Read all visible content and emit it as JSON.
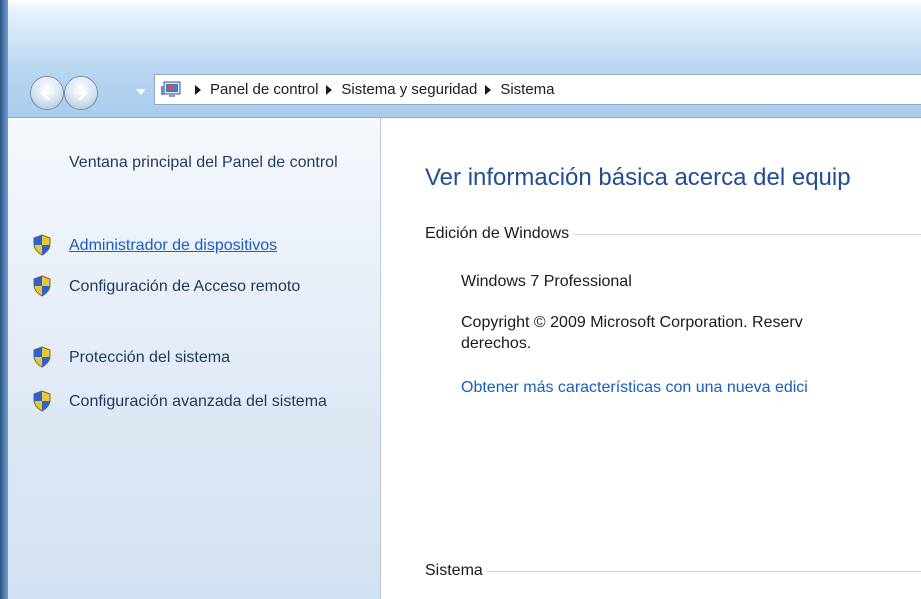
{
  "address_bar": {
    "crumbs": [
      "Panel de control",
      "Sistema y seguridad",
      "Sistema"
    ]
  },
  "sidebar": {
    "header": "Ventana principal del Panel de control",
    "tasks": [
      {
        "label": "Administrador de dispositivos",
        "icon": "uac-shield-icon",
        "style": "link"
      },
      {
        "label": "Configuración de Acceso remoto",
        "icon": "uac-shield-icon"
      },
      {
        "label": "Protección del sistema",
        "icon": "uac-shield-icon"
      },
      {
        "label": "Configuración avanzada del sistema",
        "icon": "uac-shield-icon"
      }
    ]
  },
  "main": {
    "title": "Ver información básica acerca del equip",
    "windows_edition": {
      "heading": "Edición de Windows",
      "edition": "Windows 7 Professional",
      "copyright": "Copyright © 2009 Microsoft Corporation. Reserv",
      "copyright_cont": "derechos.",
      "upgrade_link": "Obtener más características con una nueva edici"
    },
    "system": {
      "heading": "Sistema"
    }
  },
  "colors": {
    "link": "#1a5ec1",
    "title_blue": "#1f4e92",
    "sidebar_text": "#1e395b",
    "sidebar_bg": "#dfe9f5"
  }
}
